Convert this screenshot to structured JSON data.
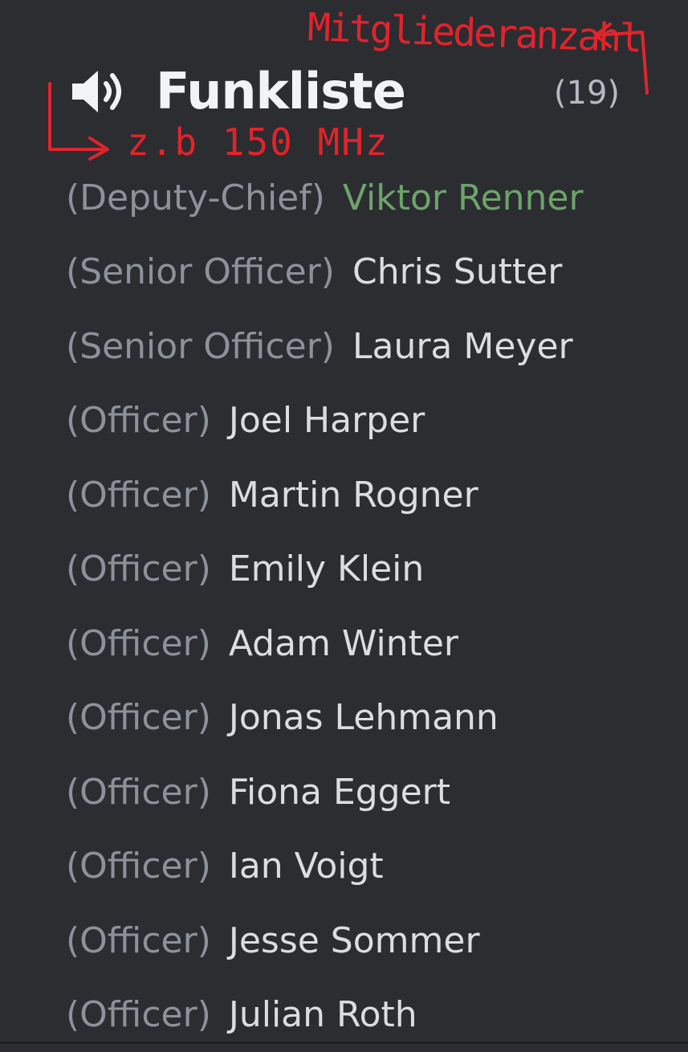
{
  "header": {
    "icon": "speaker-icon",
    "title": "Funkliste",
    "member_count": "(19)"
  },
  "annotations": {
    "members_note": "Mitgliederanzahl",
    "frequency_note": "z.b 150 MHz",
    "color": "#e0242c"
  },
  "members": [
    {
      "role": "(Deputy-Chief)",
      "name": "Viktor Renner",
      "name_color": "#6ea36b"
    },
    {
      "role": "(Senior Officer)",
      "name": "Chris Sutter"
    },
    {
      "role": "(Senior Officer)",
      "name": "Laura Meyer"
    },
    {
      "role": "(Officer)",
      "name": "Joel Harper"
    },
    {
      "role": "(Officer)",
      "name": "Martin Rogner"
    },
    {
      "role": "(Officer)",
      "name": "Emily Klein"
    },
    {
      "role": "(Officer)",
      "name": "Adam Winter"
    },
    {
      "role": "(Officer)",
      "name": "Jonas Lehmann"
    },
    {
      "role": "(Officer)",
      "name": "Fiona Eggert"
    },
    {
      "role": "(Officer)",
      "name": "Ian Voigt"
    },
    {
      "role": "(Officer)",
      "name": "Jesse Sommer"
    },
    {
      "role": "(Officer)",
      "name": "Julian Roth"
    }
  ],
  "colors": {
    "background": "#2b2d31",
    "title": "#f2f3f5",
    "role": "#8d9199",
    "name": "#dcdde1",
    "count": "#b5bac1"
  }
}
